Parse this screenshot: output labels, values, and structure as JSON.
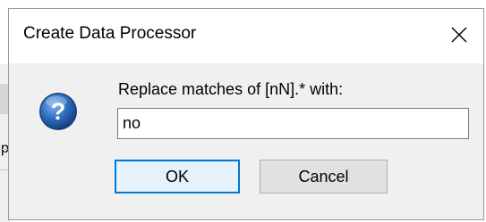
{
  "dialog": {
    "title": "Create Data Processor",
    "prompt": "Replace matches of [nN].* with:",
    "input_value": "no",
    "ok_label": "OK",
    "cancel_label": "Cancel",
    "icons": {
      "close": "close-icon",
      "question": "question-icon"
    }
  },
  "background": {
    "peek_text": "p"
  },
  "colors": {
    "dialog_bg": "#f0f0f0",
    "titlebar_bg": "#ffffff",
    "ok_border": "#0078d7",
    "ok_fill": "#e5f1fb",
    "icon_blue": "#1f5fa8"
  }
}
